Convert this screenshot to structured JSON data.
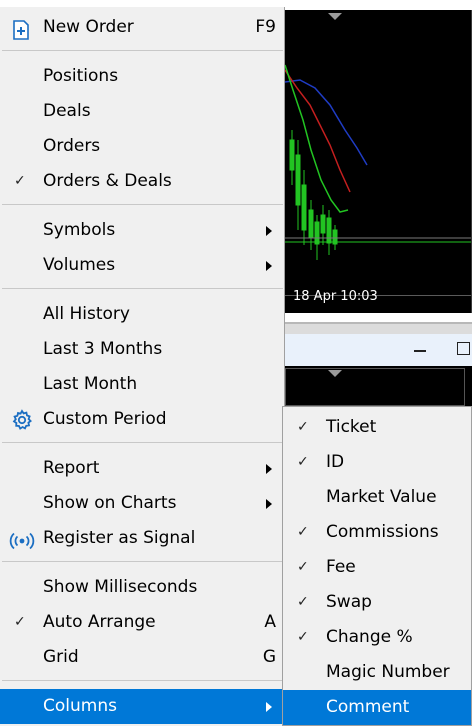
{
  "background": {
    "chart_time_label": "18 Apr 10:03"
  },
  "menu": {
    "items": [
      {
        "label": "New Order",
        "shortcut": "F9"
      },
      {
        "label": "Positions"
      },
      {
        "label": "Deals"
      },
      {
        "label": "Orders"
      },
      {
        "label": "Orders & Deals",
        "checked": true
      },
      {
        "label": "Symbols"
      },
      {
        "label": "Volumes"
      },
      {
        "label": "All History"
      },
      {
        "label": "Last 3 Months"
      },
      {
        "label": "Last Month"
      },
      {
        "label": "Custom Period"
      },
      {
        "label": "Report"
      },
      {
        "label": "Show on Charts"
      },
      {
        "label": "Register as Signal"
      },
      {
        "label": "Show Milliseconds"
      },
      {
        "label": "Auto Arrange",
        "checked": true,
        "shortcut": "A"
      },
      {
        "label": "Grid",
        "shortcut": "G"
      },
      {
        "label": "Columns"
      }
    ],
    "check_glyph": "✓"
  },
  "submenu": {
    "items": [
      {
        "label": "Ticket",
        "checked": true
      },
      {
        "label": "ID",
        "checked": true
      },
      {
        "label": "Market Value",
        "checked": false
      },
      {
        "label": "Commissions",
        "checked": true
      },
      {
        "label": "Fee",
        "checked": true
      },
      {
        "label": "Swap",
        "checked": true
      },
      {
        "label": "Change %",
        "checked": true
      },
      {
        "label": "Magic Number",
        "checked": false
      },
      {
        "label": "Comment",
        "checked": false
      }
    ]
  },
  "colors": {
    "highlight": "#0078d7",
    "menu_bg": "#f0f0f0",
    "icon_blue": "#1b6ec2"
  }
}
